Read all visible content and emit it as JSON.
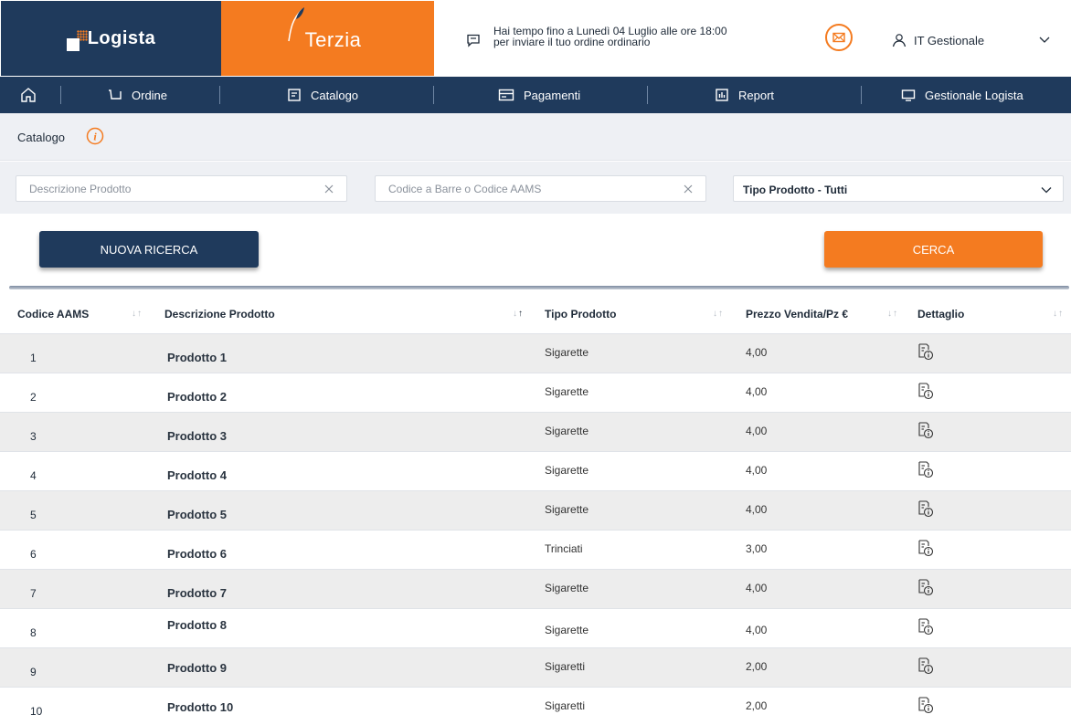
{
  "header": {
    "logo_text": "Logista",
    "partner_text": "Terzia",
    "notice_line1": "Hai tempo fino a Lunedì 04 Luglio alle ore 18:00",
    "notice_line2": "per inviare il tuo ordine ordinario",
    "user_name": "IT Gestionale"
  },
  "nav": {
    "items": [
      {
        "label": "Ordine",
        "icon": "cart-icon"
      },
      {
        "label": "Catalogo",
        "icon": "catalog-icon"
      },
      {
        "label": "Pagamenti",
        "icon": "card-icon"
      },
      {
        "label": "Report",
        "icon": "report-icon"
      },
      {
        "label": "Gestionale Logista",
        "icon": "monitor-icon"
      }
    ]
  },
  "page": {
    "title": "Catalogo"
  },
  "filters": {
    "description_placeholder": "Descrizione Prodotto",
    "description_value": "",
    "barcode_placeholder": "Codice a Barre o Codice AAMS",
    "barcode_value": "",
    "product_type_selected": "Tipo Prodotto - Tutti"
  },
  "buttons": {
    "new_search": "NUOVA RICERCA",
    "search": "CERCA"
  },
  "table": {
    "columns": [
      "Codice AAMS",
      "Descrizione Prodotto",
      "Tipo Prodotto",
      "Prezzo Vendita/Pz €",
      "Dettaglio"
    ],
    "rows": [
      {
        "code": "1",
        "description": "Prodotto 1",
        "type": "Sigarette",
        "price": "4,00"
      },
      {
        "code": "2",
        "description": "Prodotto 2",
        "type": "Sigarette",
        "price": "4,00"
      },
      {
        "code": "3",
        "description": "Prodotto 3",
        "type": "Sigarette",
        "price": "4,00"
      },
      {
        "code": "4",
        "description": "Prodotto 4",
        "type": "Sigarette",
        "price": "4,00"
      },
      {
        "code": "5",
        "description": "Prodotto 5",
        "type": "Sigarette",
        "price": "4,00"
      },
      {
        "code": "6",
        "description": "Prodotto 6",
        "type": "Trinciati",
        "price": "3,00"
      },
      {
        "code": "7",
        "description": "Prodotto 7",
        "type": "Sigarette",
        "price": "4,00"
      },
      {
        "code": "8",
        "description": "Prodotto 8",
        "type": "Sigarette",
        "price": "4,00"
      },
      {
        "code": "9",
        "description": "Prodotto 9",
        "type": "Sigaretti",
        "price": "2,00"
      },
      {
        "code": "10",
        "description": "Prodotto 10",
        "type": "Sigaretti",
        "price": "2,00"
      }
    ]
  },
  "colors": {
    "navy": "#1f3a5c",
    "orange": "#f47b20",
    "row_alt": "#ededed"
  }
}
